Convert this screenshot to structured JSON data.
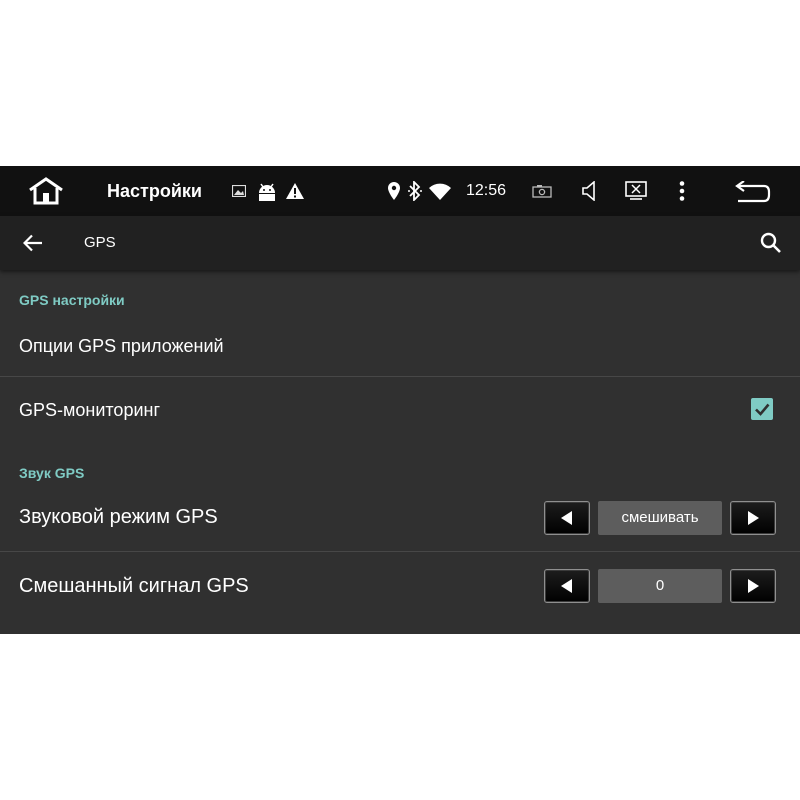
{
  "status_bar": {
    "title": "Настройки",
    "time": "12:56",
    "icons": [
      "home-icon",
      "image-icon",
      "android-icon",
      "warning-icon",
      "location-icon",
      "bluetooth-icon",
      "wifi-icon",
      "screenshot-icon",
      "volume-icon",
      "screen-off-icon",
      "more-vert-icon",
      "back-return-icon"
    ]
  },
  "action_bar": {
    "title": "GPS",
    "icons": [
      "arrow-back-icon",
      "search-icon"
    ]
  },
  "sections": {
    "gps_settings": "GPS настройки",
    "gps_sound": "Звук GPS"
  },
  "rows": {
    "app_options": {
      "label": "Опции GPS приложений"
    },
    "monitoring": {
      "label": "GPS-мониторинг",
      "checked": true
    },
    "sound_mode": {
      "label": "Звуковой режим GPS",
      "value": "смешивать"
    },
    "mixed_signal": {
      "label": "Смешанный сигнал GPS",
      "value": "0"
    }
  },
  "colors": {
    "accent": "#7fcbc4",
    "background": "#303030",
    "status_bar": "#111111",
    "action_bar": "#212121"
  }
}
